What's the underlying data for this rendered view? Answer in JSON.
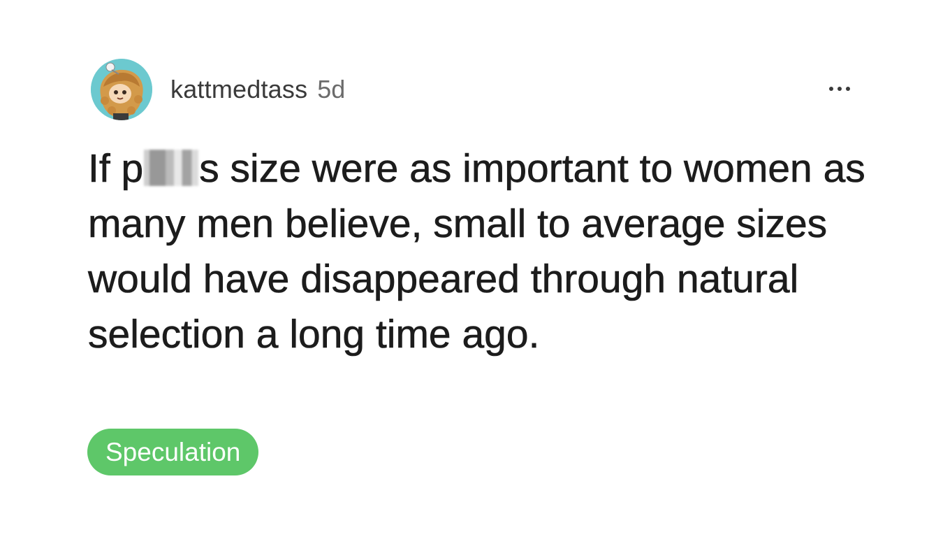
{
  "post": {
    "author": "kattmedtass",
    "age": "5d",
    "more_icon": "more-horizontal-icon",
    "avatar_icon": "user-avatar",
    "body_before_censor": "If p",
    "body_after_censor": "s size were as important to women as many men believe, small to average sizes would have disappeared through natural selection a long time ago.",
    "flair": "Speculation",
    "flair_color": "#5ec769"
  }
}
